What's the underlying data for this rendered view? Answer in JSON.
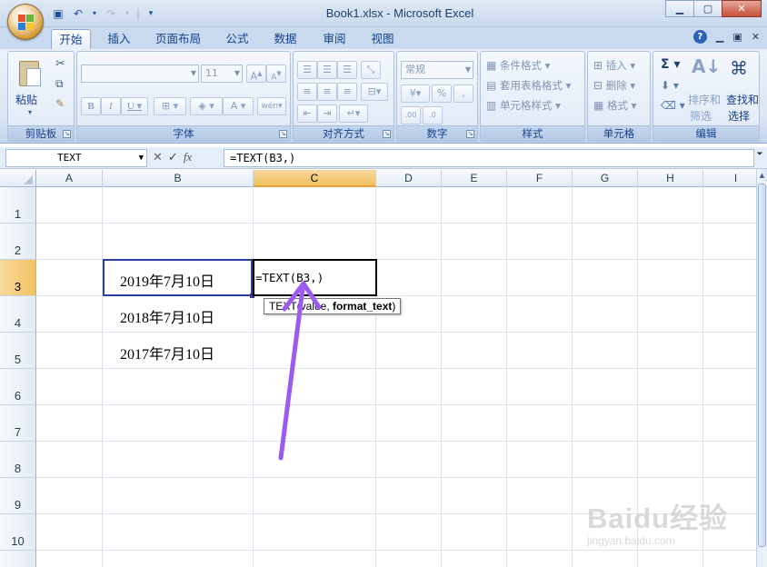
{
  "app": {
    "window_title": "Book1.xlsx - Microsoft Excel",
    "tabs": [
      "开始",
      "插入",
      "页面布局",
      "公式",
      "数据",
      "审阅",
      "视图"
    ],
    "active_tab": "开始"
  },
  "ribbon": {
    "clipboard": {
      "label": "剪贴板",
      "paste_label": "粘贴"
    },
    "font": {
      "label": "字体",
      "font_name": "",
      "font_size": "11"
    },
    "alignment": {
      "label": "对齐方式"
    },
    "number": {
      "label": "数字",
      "format": "常规",
      "percent": "%",
      "comma": ","
    },
    "styles": {
      "label": "样式",
      "conditional_format": "条件格式",
      "table_format": "套用表格格式",
      "cell_styles": "单元格样式"
    },
    "cells": {
      "label": "单元格",
      "insert": "插入",
      "delete": "删除",
      "format": "格式"
    },
    "editing": {
      "label": "编辑",
      "sort_filter": "排序和\n筛选",
      "sort_line1": "排序和",
      "sort_line2": "筛选",
      "find_line1": "查找和",
      "find_line2": "选择"
    }
  },
  "formula_bar": {
    "name_box": "TEXT",
    "formula": "=TEXT(B3,)"
  },
  "grid": {
    "columns": [
      "A",
      "B",
      "C",
      "D",
      "E",
      "F",
      "G",
      "H",
      "I"
    ],
    "selected_column": "C",
    "rows": [
      "1",
      "2",
      "3",
      "4",
      "5",
      "6",
      "7",
      "8",
      "9",
      "10"
    ],
    "selected_row": "3",
    "cells": {
      "B3": "2019年7月10日",
      "B4": "2018年7月10日",
      "B5": "2017年7月10日",
      "C3": "=TEXT(B3,)"
    },
    "tooltip": {
      "fn": "TEXT(",
      "arg1": "value",
      "sep": ", ",
      "arg2": "format_text",
      "close": ")"
    }
  },
  "watermark": {
    "logo": "Baidu经验",
    "sub": "jingyan.baidu.com"
  },
  "colors": {
    "annotation_arrow": "#9b5bf0",
    "selection_border": "#2b3d9e",
    "header_highlight": "#f1c15f"
  }
}
